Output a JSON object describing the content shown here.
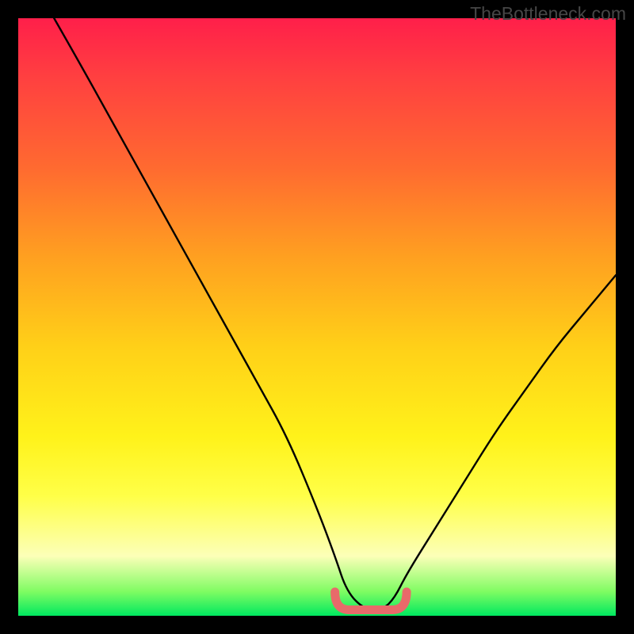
{
  "watermark": "TheBottleneck.com",
  "colors": {
    "curve_stroke": "#000000",
    "valley_stroke": "#e86a6a",
    "gradient_top": "#ff1f4a",
    "gradient_bottom": "#00e860"
  },
  "chart_data": {
    "type": "line",
    "title": "",
    "xlabel": "",
    "ylabel": "",
    "xlim": [
      0,
      100
    ],
    "ylim": [
      0,
      100
    ],
    "series": [
      {
        "name": "bottleneck-curve",
        "x": [
          6,
          10,
          15,
          20,
          25,
          30,
          35,
          40,
          45,
          50,
          53,
          55,
          58,
          61,
          63,
          65,
          70,
          75,
          80,
          85,
          90,
          95,
          100
        ],
        "values": [
          100,
          93,
          84,
          75,
          66,
          57,
          48,
          39,
          30,
          18,
          10,
          4,
          1,
          1,
          3,
          7,
          15,
          23,
          31,
          38,
          45,
          51,
          57
        ]
      }
    ],
    "annotations": [
      {
        "name": "valley-highlight",
        "x_range": [
          53,
          65
        ],
        "y": 1,
        "color": "#e86a6a"
      }
    ],
    "notes": "Axis ticks and numeric labels are not drawn in the source image; x and y are normalized 0–100. Values read from curve shape against the plot frame."
  }
}
